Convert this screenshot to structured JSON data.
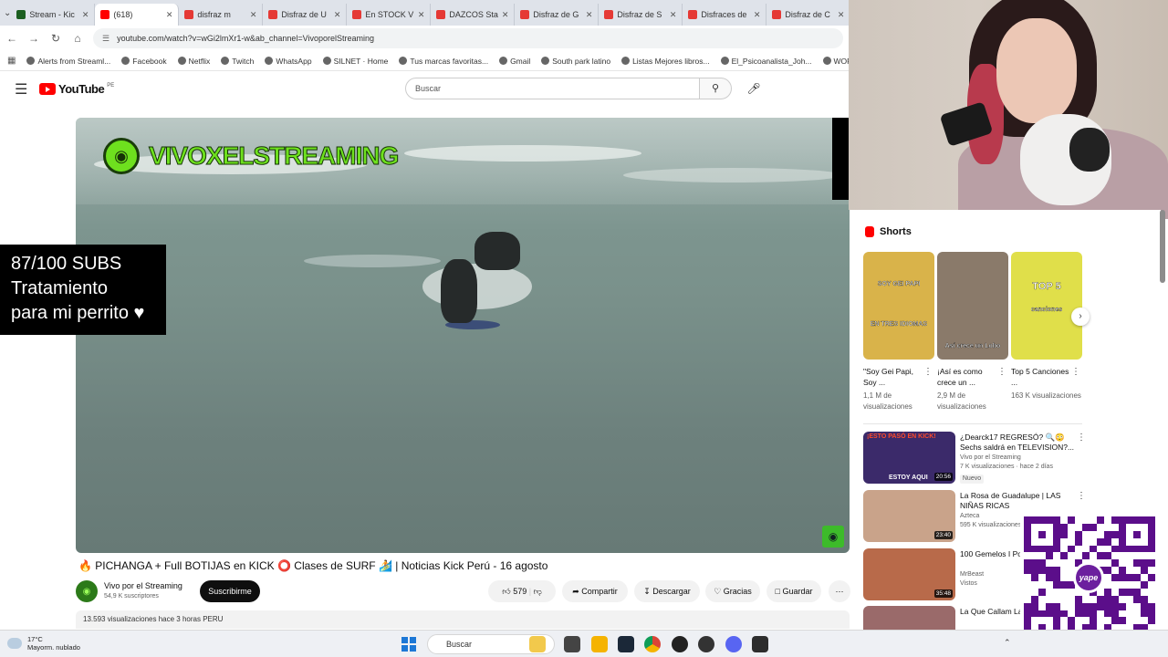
{
  "browser": {
    "tabs": [
      {
        "title": "Stream - Kic",
        "favicon": "kick",
        "active": false
      },
      {
        "title": "(618)",
        "favicon": "youtube",
        "active": true
      },
      {
        "title": "disfraz m",
        "favicon": "gmail",
        "active": false
      },
      {
        "title": "Disfraz de U",
        "favicon": "gmail",
        "active": false
      },
      {
        "title": "En STOCK V",
        "favicon": "gmail",
        "active": false
      },
      {
        "title": "DAZCOS Sta",
        "favicon": "gmail",
        "active": false
      },
      {
        "title": "Disfraz de G",
        "favicon": "gmail",
        "active": false
      },
      {
        "title": "Disfraz de S",
        "favicon": "gmail",
        "active": false
      },
      {
        "title": "Disfraces de",
        "favicon": "gmail",
        "active": false
      },
      {
        "title": "Disfraz de C",
        "favicon": "gmail",
        "active": false
      }
    ],
    "url": "youtube.com/watch?v=wGi2lmXr1-w&ab_channel=VivoporelStreaming",
    "bookmarks": [
      "Alerts from Streaml...",
      "Facebook",
      "Netflix",
      "Twitch",
      "WhatsApp",
      "SILNET · Home",
      "Tus marcas favoritas...",
      "Gmail",
      "South park latino",
      "Listas Mejores libros...",
      "El_Psicoanalista_Joh...",
      "WORD ON"
    ]
  },
  "youtube": {
    "logo_text": "YouTube",
    "logo_region": "PE",
    "search_placeholder": "Buscar",
    "overlay_channel": "VIVOXELSTREAMING",
    "subs_overlay": [
      "87/100 SUBS",
      "Tratamiento",
      "para mi perrito ♥"
    ],
    "video_title": "🔥 PICHANGA + Full BOTIJAS en KICK ⭕ Clases de SURF 🏄 | Noticias Kick Perú - 16 agosto",
    "channel_name": "Vivo por el Streaming",
    "channel_subs": "54,9 K suscriptores",
    "subscribe_label": "Suscribirme",
    "like_count": "579",
    "share_label": "Compartir",
    "download_label": "Descargar",
    "thanks_label": "Gracias",
    "save_label": "Guardar",
    "more_label": "⋯",
    "description": "13.593 visualizaciones  hace 3 horas  PERU"
  },
  "sidebar": {
    "shorts_heading": "Shorts",
    "shorts": [
      {
        "thumb_text": "SOY GEI PAPI",
        "thumb_sub": "EN TRES IDIOMAS",
        "title": "\"Soy Gei Papi, Soy ...",
        "views": "1,1 M de visualizaciones",
        "color": "#d9b34a"
      },
      {
        "thumb_text": "Así crece un Lobo",
        "thumb_sub": "",
        "title": "¡Así es como crece un ...",
        "views": "2,9 M de visualizaciones",
        "color": "#8a7a6a"
      },
      {
        "thumb_text": "TOP 5",
        "thumb_sub": "canciones",
        "title": "Top 5 Canciones ...",
        "views": "163 K visualizaciones",
        "color": "#e0df4a"
      }
    ],
    "recommended": [
      {
        "title": "¿Dearck17 REGRESÓ? 🔍😳 Sechs saldrá en TELEVISION?...",
        "channel": "Vivo por el Streaming",
        "meta": "7 K visualizaciones · hace 2 días",
        "badge": "Nuevo",
        "duration": "20:56",
        "thumb_text": "ESTOY AQUI",
        "thumb_head": "¡ESTO PASÓ EN KICK!",
        "color": "#3b2a6a"
      },
      {
        "title": "La Rosa de Guadalupe | LAS NIÑAS RICAS",
        "channel": "Azteca",
        "meta": "595 K visualizaciones",
        "badge": "",
        "duration": "23:40",
        "thumb_text": "",
        "thumb_head": "",
        "color": "#c9a38a"
      },
      {
        "title": "100 Gemelos I Por $250.000",
        "channel": "MrBeast",
        "meta": "Vistos",
        "badge": "",
        "duration": "35:48",
        "thumb_text": "",
        "thumb_head": "",
        "color": "#b86a4a"
      },
      {
        "title": "La Que Callam La señora de la",
        "channel": "",
        "meta": "",
        "badge": "",
        "duration": "",
        "thumb_text": "",
        "thumb_head": "",
        "color": "#9a6a6a"
      }
    ]
  },
  "taskbar": {
    "temperature": "17°C",
    "weather": "Mayorm. nublado",
    "search_label": "Buscar"
  },
  "colors": {
    "accent_green": "#6ee01e",
    "yt_red": "#ff0000",
    "yape_purple": "#5b0e8a"
  }
}
